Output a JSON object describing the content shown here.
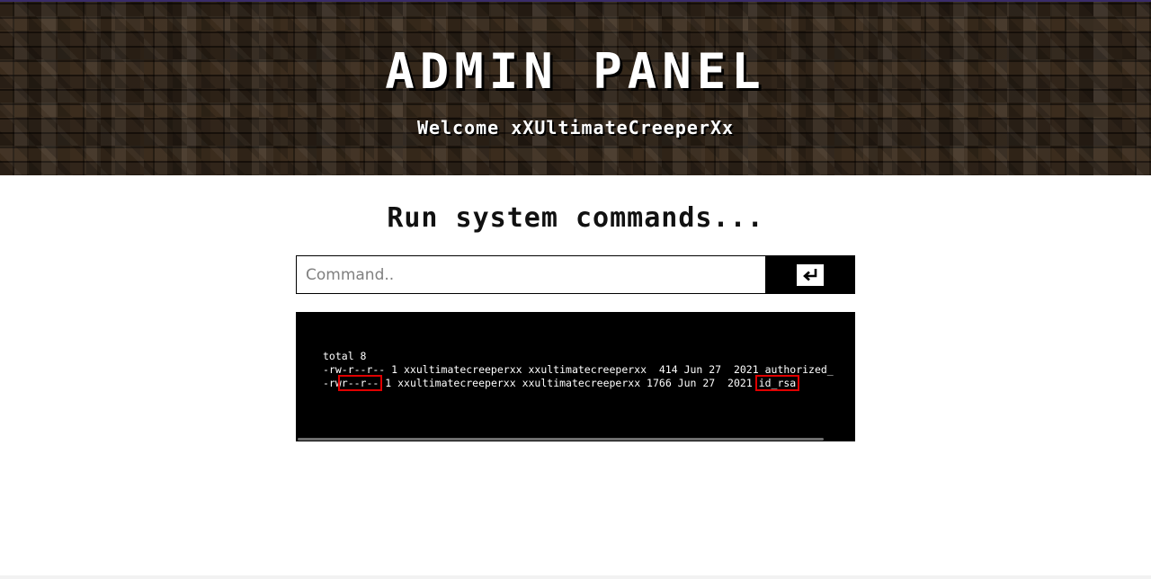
{
  "header": {
    "title": "ADMIN PANEL",
    "welcome": "Welcome xXUltimateCreeperXx"
  },
  "main": {
    "section_title": "Run system commands...",
    "command_input": {
      "value": "",
      "placeholder": "Command.."
    },
    "submit_icon": "enter-icon",
    "output": {
      "line1": "total 8",
      "line2": "-rw-r--r-- 1 xxultimatecreeperxx xxultimatecreeperxx  414 Jun 27  2021 authorized_",
      "line3_a": "-rw",
      "line3_perm": "r--r--",
      "line3_b": " 1 xxultimatecreeperxx xxultimatecreeperxx 1766 Jun 27  2021 ",
      "line3_file": "id_rsa"
    }
  },
  "colors": {
    "accent": "#3a2d6a",
    "highlight": "#e00000",
    "terminal_bg": "#000000",
    "terminal_fg": "#ffffff"
  }
}
